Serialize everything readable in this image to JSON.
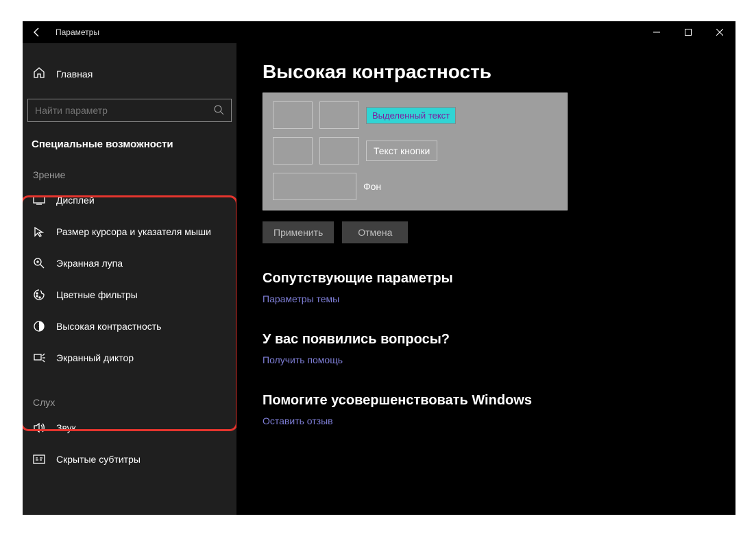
{
  "titlebar": {
    "app_name": "Параметры"
  },
  "sidebar": {
    "home": "Главная",
    "search_placeholder": "Найти параметр",
    "category": "Специальные возможности",
    "group_vision": "Зрение",
    "items_vision": {
      "display": "Дисплей",
      "cursor": "Размер курсора и указателя мыши",
      "magnifier": "Экранная лупа",
      "color_filters": "Цветные фильтры",
      "high_contrast": "Высокая контрастность",
      "narrator": "Экранный диктор"
    },
    "group_hearing": "Слух",
    "items_hearing": {
      "sound": "Звук",
      "captions": "Скрытые субтитры"
    }
  },
  "main": {
    "title": "Высокая контрастность",
    "preview": {
      "selected_text": "Выделенный текст",
      "button_text": "Текст кнопки",
      "background": "Фон"
    },
    "buttons": {
      "apply": "Применить",
      "cancel": "Отмена"
    },
    "related_heading": "Сопутствующие параметры",
    "related_link": "Параметры темы",
    "questions_heading": "У вас появились вопросы?",
    "help_link": "Получить помощь",
    "feedback_heading": "Помогите усовершенствовать Windows",
    "feedback_link": "Оставить отзыв"
  }
}
